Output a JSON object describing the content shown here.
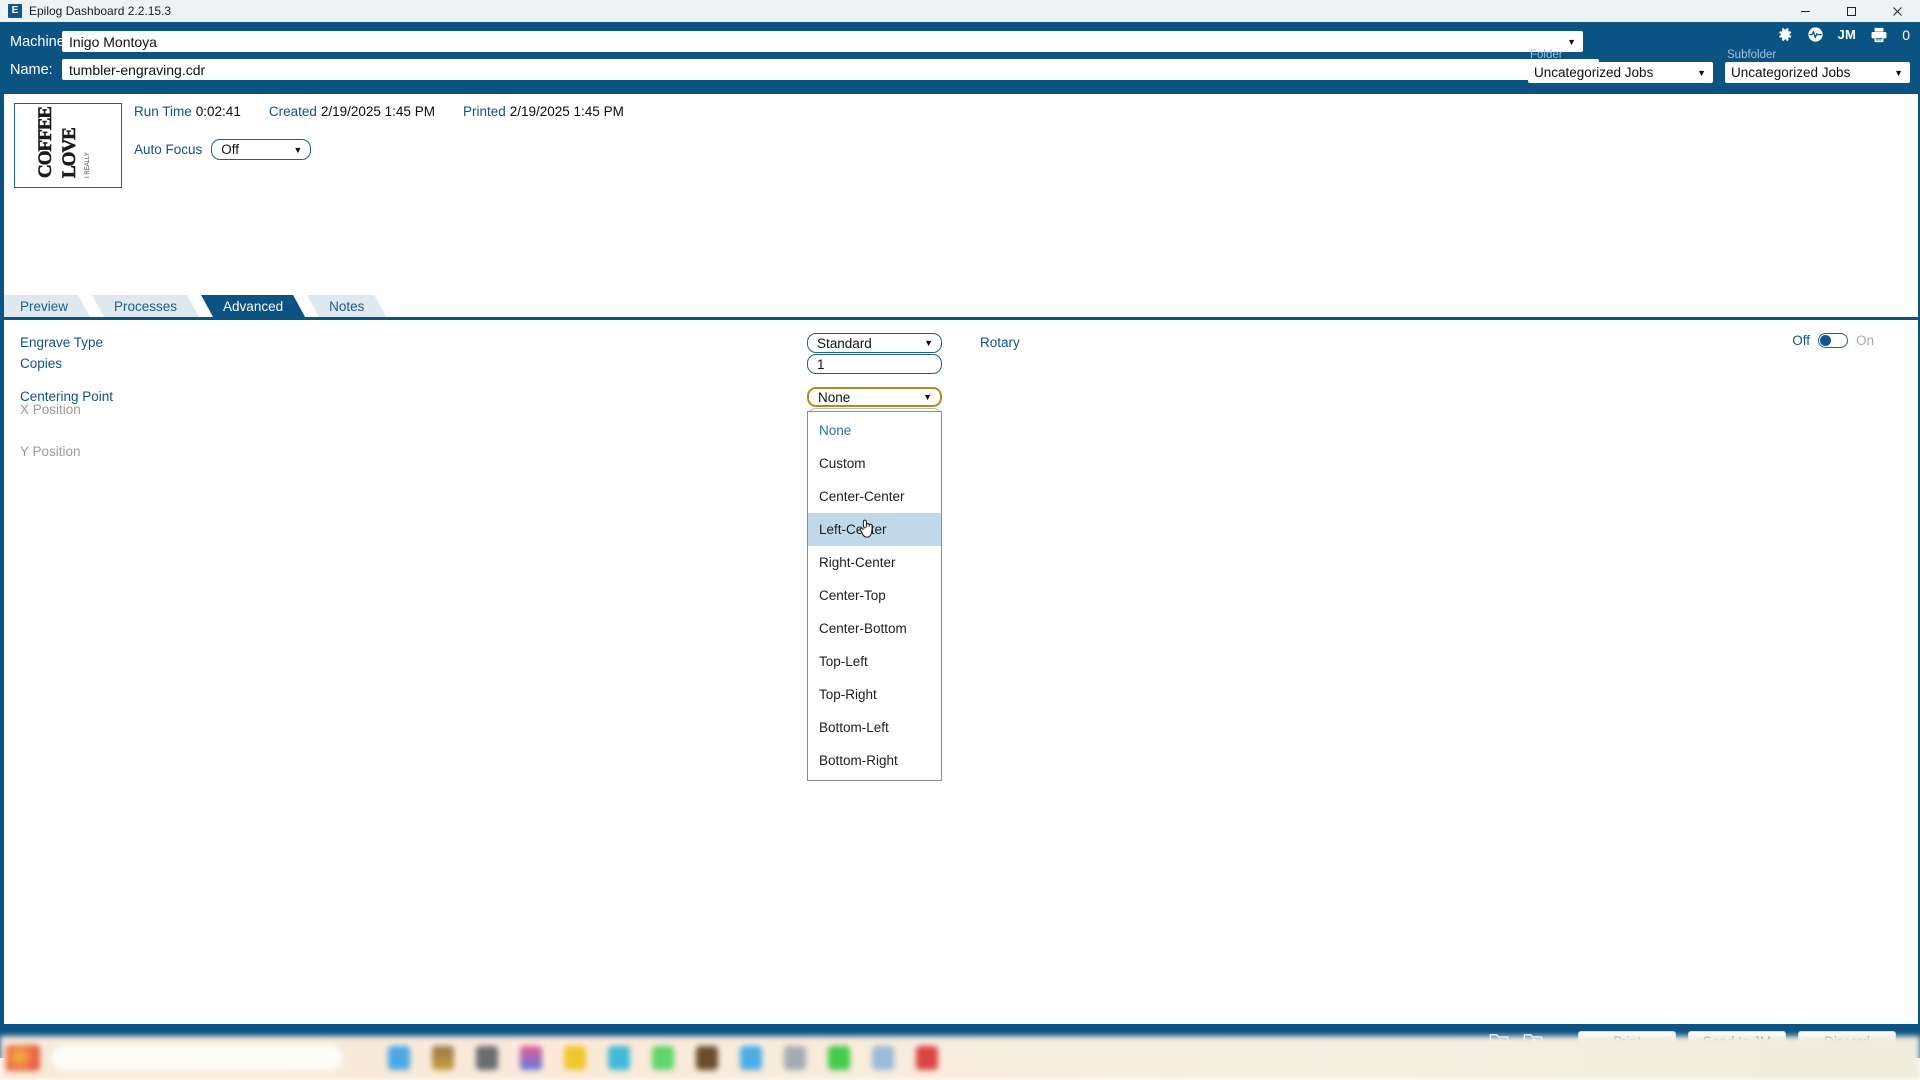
{
  "window": {
    "title": "Epilog Dashboard 2.2.15.3",
    "app_icon": "E",
    "minimize_icon": "minimize-icon",
    "maximize_icon": "maximize-icon",
    "close_icon": "close-icon"
  },
  "header": {
    "machine_label": "Machine:",
    "machine_value": "Inigo Montoya",
    "name_label": "Name:",
    "name_value": "tumbler-engraving.cdr",
    "tray": {
      "settings_icon": "gear-icon",
      "status_icon": "activity-pulse-icon",
      "user_initials": "JM",
      "printer_icon": "printer-icon",
      "queue_count": "0"
    },
    "folder": {
      "label": "Folder",
      "value": "Uncategorized Jobs"
    },
    "subfolder": {
      "label": "Subfolder",
      "value": "Uncategorized Jobs"
    }
  },
  "job": {
    "thumbnail_alt": "engraved coffee artwork thumbnail",
    "run_time_label": "Run Time",
    "run_time_value": "0:02:41",
    "created_label": "Created",
    "created_value": "2/19/2025 1:45 PM",
    "printed_label": "Printed",
    "printed_value": "2/19/2025 1:45 PM",
    "auto_focus_label": "Auto Focus",
    "auto_focus_value": "Off"
  },
  "tabs": [
    {
      "label": "Preview",
      "active": false
    },
    {
      "label": "Processes",
      "active": false
    },
    {
      "label": "Advanced",
      "active": true
    },
    {
      "label": "Notes",
      "active": false
    }
  ],
  "settings": {
    "engrave_type_label": "Engrave Type",
    "engrave_type_value": "Standard",
    "copies_label": "Copies",
    "copies_value": "1",
    "centering_point_label": "Centering Point",
    "centering_point_value": "None",
    "x_position_label": "X Position",
    "x_position_value": "",
    "y_position_label": "Y Position",
    "y_position_value": "",
    "rotary_label": "Rotary",
    "rotary_off_label": "Off",
    "rotary_on_label": "On",
    "rotary_state": "Off"
  },
  "centering_dropdown": {
    "open": true,
    "options": [
      {
        "label": "None",
        "selected": true,
        "hovered": false
      },
      {
        "label": "Custom",
        "selected": false,
        "hovered": false
      },
      {
        "label": "Center-Center",
        "selected": false,
        "hovered": false
      },
      {
        "label": "Left-Center",
        "selected": false,
        "hovered": true
      },
      {
        "label": "Right-Center",
        "selected": false,
        "hovered": false
      },
      {
        "label": "Center-Top",
        "selected": false,
        "hovered": false
      },
      {
        "label": "Center-Bottom",
        "selected": false,
        "hovered": false
      },
      {
        "label": "Top-Left",
        "selected": false,
        "hovered": false
      },
      {
        "label": "Top-Right",
        "selected": false,
        "hovered": false
      },
      {
        "label": "Bottom-Left",
        "selected": false,
        "hovered": false
      },
      {
        "label": "Bottom-Right",
        "selected": false,
        "hovered": false
      }
    ]
  },
  "action_bar": {
    "import_icon": "folder-download-icon",
    "export_icon": "folder-upload-icon",
    "print_label": "Print",
    "send_label": "Send to JM",
    "discard_label": "Discard"
  },
  "colors": {
    "brand_blue": "#0a5383",
    "label_blue": "#12537f",
    "disabled_gray": "#9a9a9a",
    "dropdown_hover": "#bfd9ea",
    "tab_inactive": "#dfe8ee"
  }
}
